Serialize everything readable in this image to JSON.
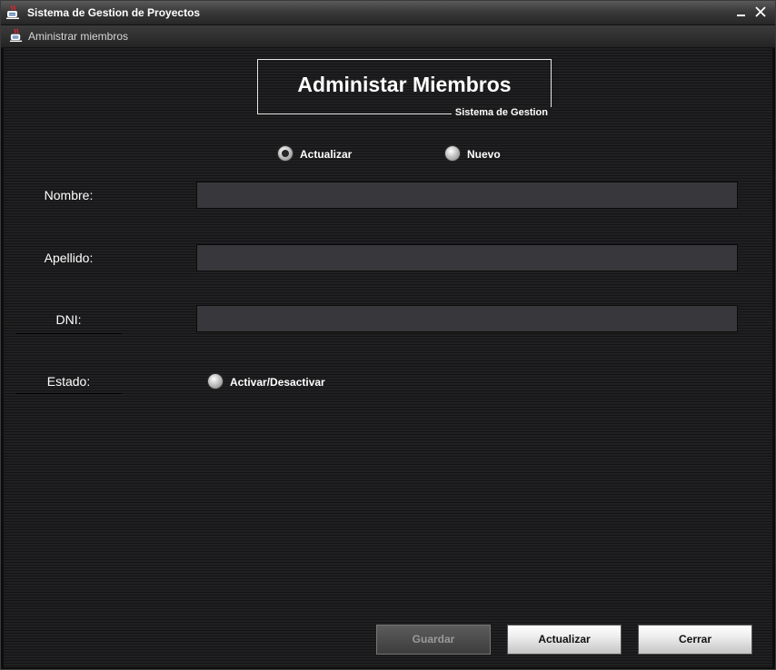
{
  "window": {
    "title": "Sistema de Gestion de Proyectos",
    "icon": "java-cup-icon"
  },
  "internal_frame": {
    "title": "Aministrar miembros"
  },
  "header": {
    "title": "Administar Miembros",
    "subtitle": "Sistema de Gestion"
  },
  "mode_options": [
    {
      "label": "Actualizar",
      "selected": true
    },
    {
      "label": "Nuevo",
      "selected": false
    }
  ],
  "form": {
    "nombre_label": "Nombre:",
    "nombre_value": "",
    "apellido_label": "Apellido:",
    "apellido_value": "",
    "dni_label": "DNI:",
    "dni_value": "",
    "estado_label": "Estado:",
    "estado_option": "Activar/Desactivar"
  },
  "buttons": {
    "guardar": "Guardar",
    "actualizar": "Actualizar",
    "cerrar": "Cerrar"
  }
}
